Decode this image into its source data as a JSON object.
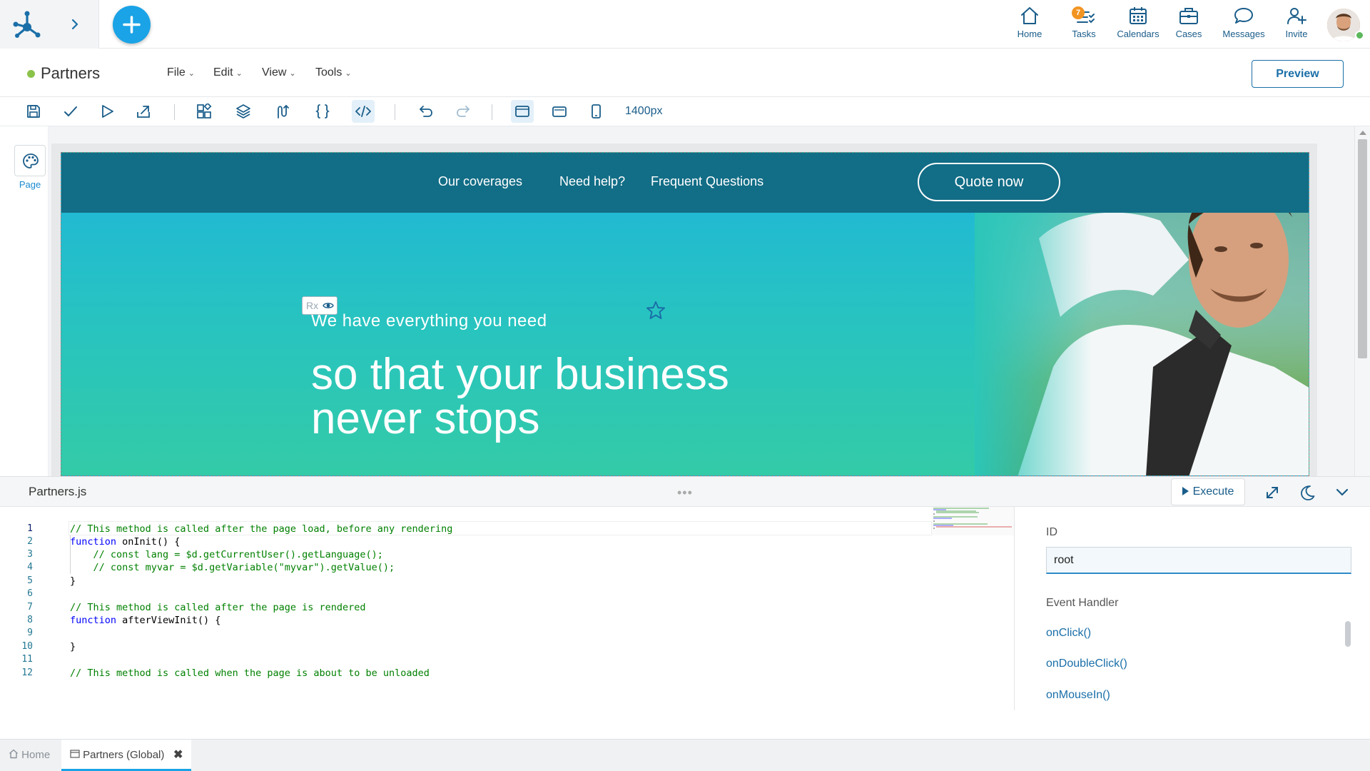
{
  "topnav": {
    "items": [
      {
        "label": "Home",
        "icon": "home-icon"
      },
      {
        "label": "Tasks",
        "icon": "tasks-icon",
        "badge": "7"
      },
      {
        "label": "Calendars",
        "icon": "calendar-icon"
      },
      {
        "label": "Cases",
        "icon": "briefcase-icon"
      },
      {
        "label": "Messages",
        "icon": "chat-icon"
      },
      {
        "label": "Invite",
        "icon": "add-user-icon"
      }
    ]
  },
  "header": {
    "title": "Partners",
    "menus": [
      "File",
      "Edit",
      "View",
      "Tools"
    ],
    "preview_label": "Preview"
  },
  "toolbar": {
    "zoom": "1400px"
  },
  "left_panel": {
    "page_label": "Page"
  },
  "site": {
    "nav": [
      "Our coverages",
      "Need help?",
      "Frequent Questions"
    ],
    "quote_label": "Quote now",
    "hero_subtitle": "We have everything you need",
    "hero_title": "so that your business never stops",
    "rx_badge": "Rx"
  },
  "editor": {
    "file_name": "Partners.js",
    "execute_label": "Execute",
    "drag_handle": "•••",
    "line_numbers": [
      "1",
      "2",
      "3",
      "4",
      "5",
      "6",
      "7",
      "8",
      "9",
      "10",
      "11",
      "12"
    ],
    "lines": {
      "l1": "// This method is called after the page load, before any rendering",
      "l2_kw": "function",
      "l2_rest": " onInit() {",
      "l3_pre": "    // const lang = $d.getCurrentUser().getLanguage();",
      "l4_pre": "    // const myvar = $d.getVariable(\"myvar\").getValue();",
      "l5": "}",
      "l7": "// This method is called after the page is rendered",
      "l8_kw": "function",
      "l8_rest": " afterViewInit() {",
      "l10": "}",
      "l12": "// This method is called when the page is about to be unloaded"
    }
  },
  "properties": {
    "id_label": "ID",
    "id_value": "root",
    "event_label": "Event Handler",
    "handlers": [
      "onClick()",
      "onDoubleClick()",
      "onMouseIn()"
    ]
  },
  "bottom_tabs": {
    "home": "Home",
    "active": "Partners (Global)",
    "close": "✖"
  },
  "colors": {
    "accent": "#1aa3e6",
    "brand_dark": "#1a5d8a",
    "site_nav": "#126d86",
    "status_green": "#8bc34a",
    "badge_orange": "#f29422"
  }
}
